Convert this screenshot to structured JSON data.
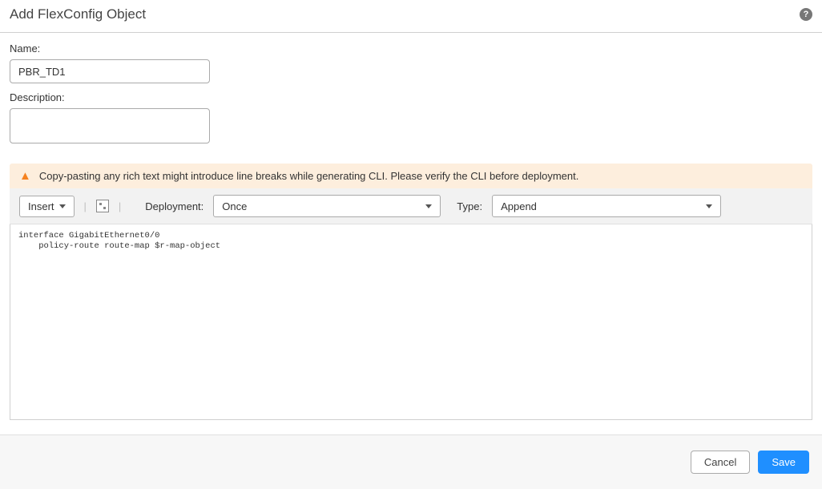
{
  "header": {
    "title": "Add FlexConfig Object",
    "help_icon": "?"
  },
  "form": {
    "name_label": "Name:",
    "name_value": "PBR_TD1",
    "desc_label": "Description:",
    "desc_value": ""
  },
  "warning": {
    "text": "Copy-pasting any rich text might introduce line breaks while generating CLI. Please verify the CLI before deployment."
  },
  "toolbar": {
    "insert_label": "Insert",
    "deployment_label": "Deployment:",
    "deployment_value": "Once",
    "type_label": "Type:",
    "type_value": "Append"
  },
  "code": {
    "content": "interface GigabitEthernet0/0\n    policy-route route-map $r-map-object"
  },
  "footer": {
    "cancel_label": "Cancel",
    "save_label": "Save"
  }
}
